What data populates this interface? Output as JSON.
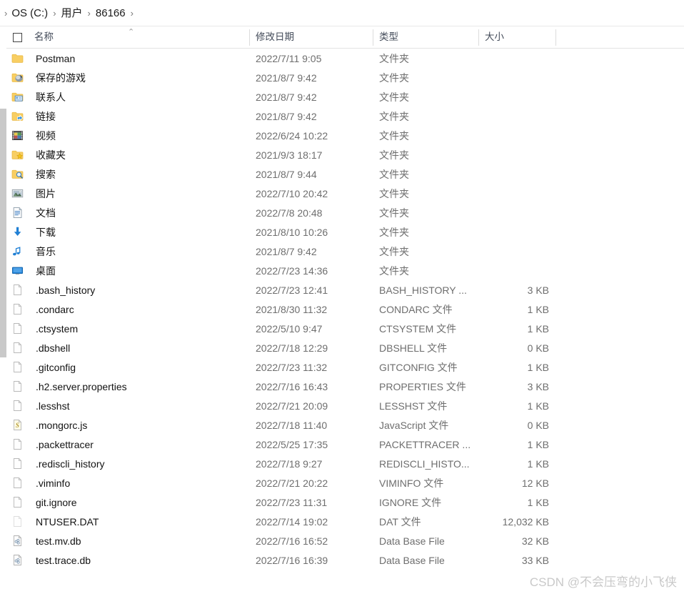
{
  "window": {
    "title": "86166"
  },
  "breadcrumb": {
    "lead_chevron": "›",
    "separator": "›",
    "items": [
      {
        "label": "OS (C:)"
      },
      {
        "label": "用户"
      },
      {
        "label": "86166"
      }
    ],
    "trailing_chevron": "›"
  },
  "columns": {
    "select_all_checkbox": "",
    "name": "名称",
    "date_modified": "修改日期",
    "type": "类型",
    "size": "大小",
    "sort_indicator": "⌃",
    "sort_column": "名称",
    "sort_direction": "ascending"
  },
  "files": [
    {
      "name": "Postman",
      "date": "2022/7/11 9:05",
      "type": "文件夹",
      "size": "",
      "icon": "folder-icon"
    },
    {
      "name": "保存的游戏",
      "date": "2021/8/7 9:42",
      "type": "文件夹",
      "size": "",
      "icon": "saved-games-folder-icon"
    },
    {
      "name": "联系人",
      "date": "2021/8/7 9:42",
      "type": "文件夹",
      "size": "",
      "icon": "contacts-folder-icon"
    },
    {
      "name": "链接",
      "date": "2021/8/7 9:42",
      "type": "文件夹",
      "size": "",
      "icon": "links-folder-icon"
    },
    {
      "name": "视频",
      "date": "2022/6/24 10:22",
      "type": "文件夹",
      "size": "",
      "icon": "videos-folder-icon"
    },
    {
      "name": "收藏夹",
      "date": "2021/9/3 18:17",
      "type": "文件夹",
      "size": "",
      "icon": "favorites-folder-icon"
    },
    {
      "name": "搜索",
      "date": "2021/8/7 9:44",
      "type": "文件夹",
      "size": "",
      "icon": "searches-folder-icon"
    },
    {
      "name": "图片",
      "date": "2022/7/10 20:42",
      "type": "文件夹",
      "size": "",
      "icon": "pictures-folder-icon"
    },
    {
      "name": "文档",
      "date": "2022/7/8 20:48",
      "type": "文件夹",
      "size": "",
      "icon": "documents-folder-icon"
    },
    {
      "name": "下载",
      "date": "2021/8/10 10:26",
      "type": "文件夹",
      "size": "",
      "icon": "downloads-folder-icon"
    },
    {
      "name": "音乐",
      "date": "2021/8/7 9:42",
      "type": "文件夹",
      "size": "",
      "icon": "music-folder-icon"
    },
    {
      "name": "桌面",
      "date": "2022/7/23 14:36",
      "type": "文件夹",
      "size": "",
      "icon": "desktop-folder-icon"
    },
    {
      "name": ".bash_history",
      "date": "2022/7/23 12:41",
      "type": "BASH_HISTORY ...",
      "size": "3 KB",
      "icon": "generic-file-icon"
    },
    {
      "name": ".condarc",
      "date": "2021/8/30 11:32",
      "type": "CONDARC 文件",
      "size": "1 KB",
      "icon": "generic-file-icon"
    },
    {
      "name": ".ctsystem",
      "date": "2022/5/10 9:47",
      "type": "CTSYSTEM 文件",
      "size": "1 KB",
      "icon": "generic-file-icon"
    },
    {
      "name": ".dbshell",
      "date": "2022/7/18 12:29",
      "type": "DBSHELL 文件",
      "size": "0 KB",
      "icon": "generic-file-icon"
    },
    {
      "name": ".gitconfig",
      "date": "2022/7/23 11:32",
      "type": "GITCONFIG 文件",
      "size": "1 KB",
      "icon": "generic-file-icon"
    },
    {
      "name": ".h2.server.properties",
      "date": "2022/7/16 16:43",
      "type": "PROPERTIES 文件",
      "size": "3 KB",
      "icon": "generic-file-icon"
    },
    {
      "name": ".lesshst",
      "date": "2022/7/21 20:09",
      "type": "LESSHST 文件",
      "size": "1 KB",
      "icon": "generic-file-icon"
    },
    {
      "name": ".mongorc.js",
      "date": "2022/7/18 11:40",
      "type": "JavaScript 文件",
      "size": "0 KB",
      "icon": "javascript-file-icon"
    },
    {
      "name": ".packettracer",
      "date": "2022/5/25 17:35",
      "type": "PACKETTRACER ...",
      "size": "1 KB",
      "icon": "generic-file-icon"
    },
    {
      "name": ".rediscli_history",
      "date": "2022/7/18 9:27",
      "type": "REDISCLI_HISTO...",
      "size": "1 KB",
      "icon": "generic-file-icon"
    },
    {
      "name": ".viminfo",
      "date": "2022/7/21 20:22",
      "type": "VIMINFO 文件",
      "size": "12 KB",
      "icon": "generic-file-icon"
    },
    {
      "name": "git.ignore",
      "date": "2022/7/23 11:31",
      "type": "IGNORE 文件",
      "size": "1 KB",
      "icon": "generic-file-icon"
    },
    {
      "name": "NTUSER.DAT",
      "date": "2022/7/14 19:02",
      "type": "DAT 文件",
      "size": "12,032 KB",
      "icon": "hidden-file-icon"
    },
    {
      "name": "test.mv.db",
      "date": "2022/7/16 16:52",
      "type": "Data Base File",
      "size": "32 KB",
      "icon": "database-file-icon"
    },
    {
      "name": "test.trace.db",
      "date": "2022/7/16 16:39",
      "type": "Data Base File",
      "size": "33 KB",
      "icon": "database-file-icon"
    }
  ],
  "scrollbar": {
    "orientation": "vertical",
    "position": "left"
  },
  "watermark": {
    "text": "CSDN @不会压弯的小飞侠"
  },
  "colors": {
    "folder": "#f8ce63",
    "folder_dark": "#e8b63c",
    "accent_blue": "#1c7fd6",
    "text_primary": "#131313",
    "text_secondary": "#6e6e6e",
    "header_text": "#444c5a",
    "scrollbar_thumb": "#c9c9c9",
    "watermark": "#c9c9c9"
  }
}
